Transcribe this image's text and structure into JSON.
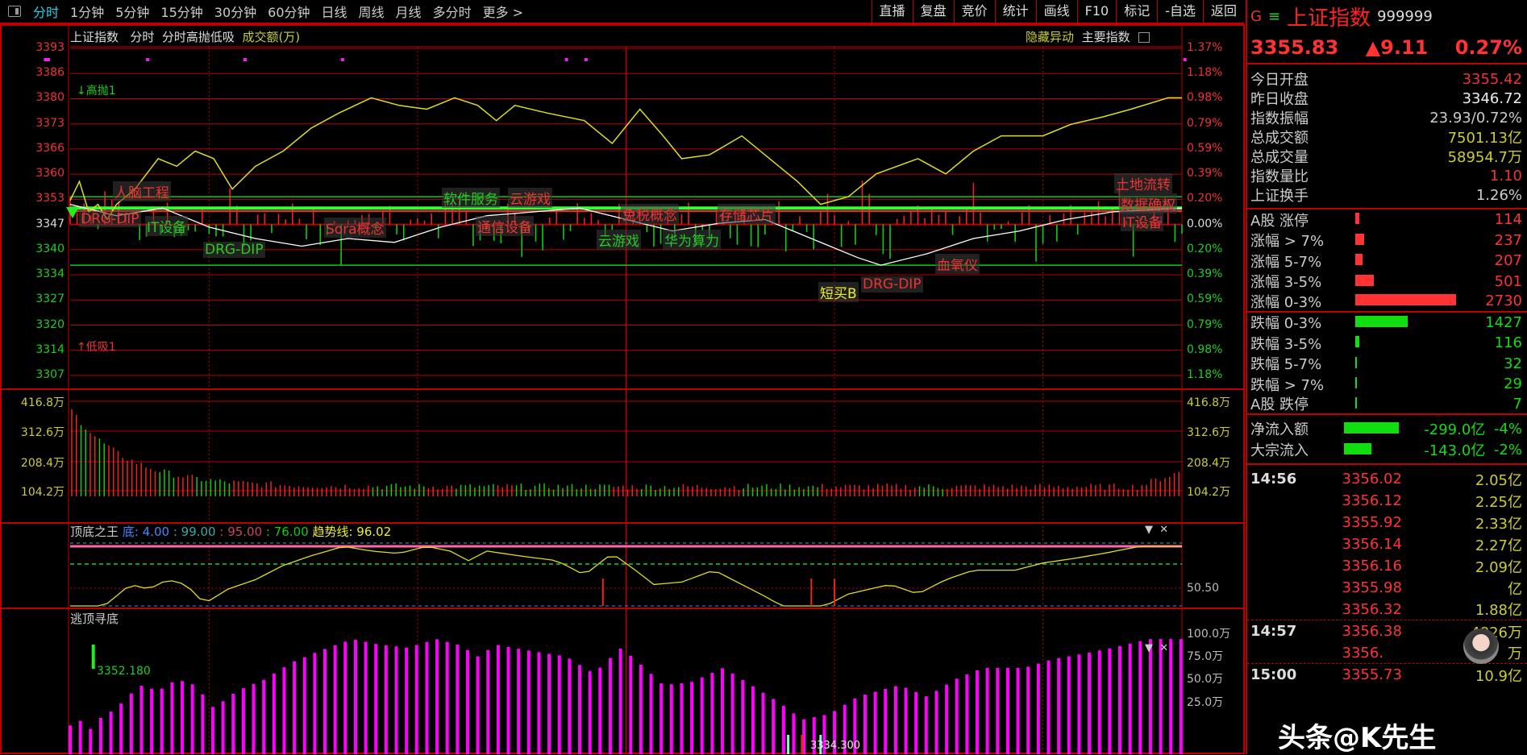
{
  "toolbar": {
    "tabs": [
      "分时",
      "1分钟",
      "5分钟",
      "15分钟",
      "30分钟",
      "60分钟",
      "日线",
      "周线",
      "月线",
      "多分时",
      "更多 >"
    ],
    "active_tab": "分时",
    "right_buttons": [
      "直播",
      "复盘",
      "竞价",
      "统计",
      "画线",
      "F10",
      "标记",
      "-自选",
      "返回"
    ]
  },
  "main_chart": {
    "title": "上证指数",
    "mode": "分时",
    "indicator": "分时高抛低吸",
    "volume_unit": "成交额(万)",
    "right_links": [
      "隐藏异动",
      "主要指数"
    ],
    "price_ticks": [
      "3393",
      "3386",
      "3380",
      "3373",
      "3366",
      "3360",
      "3353",
      "3347",
      "3340",
      "3334",
      "3327",
      "3320",
      "3314",
      "3307"
    ],
    "pct_ticks": [
      "1.37%",
      "1.18%",
      "0.98%",
      "0.79%",
      "0.59%",
      "0.39%",
      "0.20%",
      "0.00%",
      "0.20%",
      "0.39%",
      "0.59%",
      "0.79%",
      "0.98%",
      "1.18%"
    ],
    "volume_ticks": [
      "416.8万",
      "312.6万",
      "208.4万",
      "104.2万"
    ],
    "markers": {
      "sell": "高抛1",
      "buy": "低吸1"
    },
    "concept_labels": [
      {
        "text": "人脑工程",
        "color": "#e33"
      },
      {
        "text": "软件服务",
        "color": "#2c2"
      },
      {
        "text": "云游戏",
        "color": "#e33"
      },
      {
        "text": "DRG-DIP",
        "color": "#e33"
      },
      {
        "text": "IT设备",
        "color": "#2c2"
      },
      {
        "text": "DRG-DIP",
        "color": "#2c2"
      },
      {
        "text": "Sora概念",
        "color": "#e33"
      },
      {
        "text": "通信设备",
        "color": "#e33"
      },
      {
        "text": "免税概念",
        "color": "#e33"
      },
      {
        "text": "存储芯片",
        "color": "#e33"
      },
      {
        "text": "云游戏",
        "color": "#2c2"
      },
      {
        "text": "华为算力",
        "color": "#2c2"
      },
      {
        "text": "短买B",
        "color": "#ee3"
      },
      {
        "text": "DRG-DIP",
        "color": "#e33"
      },
      {
        "text": "血氧仪",
        "color": "#e33"
      },
      {
        "text": "土地流转",
        "color": "#e33"
      },
      {
        "text": "数据确权",
        "color": "#e33"
      },
      {
        "text": "IT设备",
        "color": "#e33"
      }
    ],
    "price_series": [
      [
        0,
        3353
      ],
      [
        2,
        3358
      ],
      [
        4,
        3350
      ],
      [
        6,
        3352
      ],
      [
        8,
        3348
      ],
      [
        10,
        3352
      ],
      [
        14,
        3356
      ],
      [
        19,
        3364
      ],
      [
        23,
        3362
      ],
      [
        27,
        3366
      ],
      [
        31,
        3364
      ],
      [
        35,
        3356
      ],
      [
        40,
        3362
      ],
      [
        46,
        3366
      ],
      [
        52,
        3372
      ],
      [
        58,
        3376
      ],
      [
        65,
        3380
      ],
      [
        71,
        3378
      ],
      [
        77,
        3377
      ],
      [
        83,
        3380
      ],
      [
        88,
        3378
      ],
      [
        92,
        3374
      ],
      [
        96,
        3378
      ],
      [
        103,
        3376
      ],
      [
        111,
        3374
      ],
      [
        117,
        3368
      ],
      [
        123,
        3377
      ],
      [
        128,
        3370
      ],
      [
        132,
        3364
      ],
      [
        138,
        3365
      ],
      [
        145,
        3370
      ],
      [
        151,
        3364
      ],
      [
        157,
        3358
      ],
      [
        162,
        3352
      ],
      [
        168,
        3354
      ],
      [
        174,
        3360
      ],
      [
        183,
        3364
      ],
      [
        189,
        3360
      ],
      [
        195,
        3366
      ],
      [
        201,
        3370
      ],
      [
        210,
        3370
      ],
      [
        216,
        3373
      ],
      [
        223,
        3375
      ],
      [
        229,
        3377
      ],
      [
        237,
        3380
      ],
      [
        240,
        3380
      ]
    ],
    "avg_series": [
      [
        0,
        3352
      ],
      [
        10,
        3349
      ],
      [
        20,
        3351
      ],
      [
        30,
        3346
      ],
      [
        40,
        3343
      ],
      [
        50,
        3341
      ],
      [
        60,
        3343
      ],
      [
        70,
        3342
      ],
      [
        80,
        3346
      ],
      [
        90,
        3349
      ],
      [
        100,
        3350
      ],
      [
        110,
        3351
      ],
      [
        120,
        3348
      ],
      [
        130,
        3345
      ],
      [
        140,
        3347
      ],
      [
        150,
        3348
      ],
      [
        160,
        3343
      ],
      [
        170,
        3338
      ],
      [
        175,
        3336
      ],
      [
        185,
        3339
      ],
      [
        195,
        3343
      ],
      [
        205,
        3345
      ],
      [
        215,
        3348
      ],
      [
        225,
        3350
      ],
      [
        240,
        3351
      ]
    ]
  },
  "indicator1": {
    "name": "顶底之王",
    "label_di": "底",
    "v1": ": 4.00",
    "v2": ": 99.00",
    "v3": ": 95.00",
    "v4": ": 76.00",
    "trend_label": "趋势线",
    "trend_value": ": 96.02",
    "axis_mid": "50.50"
  },
  "indicator2": {
    "name": "逃顶寻底",
    "annotation": "3352.180",
    "annotation2": "3334.300",
    "ticks": [
      "100.0万",
      "75.0万",
      "50.0万",
      "25.0万"
    ]
  },
  "quote": {
    "badge": "G",
    "menu": "≡",
    "name": "上证指数",
    "code": "999999",
    "price": "3355.83",
    "change": "▲9.11",
    "pct": "0.27%",
    "info": [
      {
        "label": "今日开盘",
        "value": "3355.42",
        "color": "#e33"
      },
      {
        "label": "昨日收盘",
        "value": "3346.72",
        "color": "#eee"
      },
      {
        "label": "指数振幅",
        "value": "23.93/0.72%",
        "color": "#ccc"
      },
      {
        "label": "总成交额",
        "value": "7501.13亿",
        "color": "#cc3"
      },
      {
        "label": "总成交量",
        "value": "58954.7万",
        "color": "#cc3"
      },
      {
        "label": "指数量比",
        "value": "1.10",
        "color": "#e33"
      },
      {
        "label": "上证换手",
        "value": "1.26%",
        "color": "#ccc"
      }
    ],
    "breadth": [
      {
        "label": "A股 涨停",
        "count": "114",
        "n": 114,
        "color": "#f33"
      },
      {
        "label": "涨幅 > 7%",
        "count": "237",
        "n": 237,
        "color": "#f33"
      },
      {
        "label": "涨幅 5-7%",
        "count": "207",
        "n": 207,
        "color": "#f33"
      },
      {
        "label": "涨幅 3-5%",
        "count": "501",
        "n": 501,
        "color": "#f33"
      },
      {
        "label": "涨幅 0-3%",
        "count": "2730",
        "n": 2730,
        "color": "#f33"
      },
      {
        "label": "跌幅 0-3%",
        "count": "1427",
        "n": 1427,
        "color": "#1d1"
      },
      {
        "label": "跌幅 3-5%",
        "count": "116",
        "n": 116,
        "color": "#1d1"
      },
      {
        "label": "跌幅 5-7%",
        "count": "32",
        "n": 32,
        "color": "#1d1"
      },
      {
        "label": "跌幅 > 7%",
        "count": "29",
        "n": 29,
        "color": "#1d1"
      },
      {
        "label": "A股 跌停",
        "count": "7",
        "n": 7,
        "color": "#1d1"
      }
    ],
    "flows": [
      {
        "label": "净流入额",
        "value": "-299.0亿",
        "pct": "-4%",
        "n": 4
      },
      {
        "label": "大宗流入",
        "value": "-143.0亿",
        "pct": "-2%",
        "n": 2
      }
    ],
    "ticks": [
      {
        "time": "14:56",
        "price": "3356.02",
        "amount": "2.05亿"
      },
      {
        "time": "",
        "price": "3356.12",
        "amount": "2.25亿"
      },
      {
        "time": "",
        "price": "3355.92",
        "amount": "2.33亿"
      },
      {
        "time": "",
        "price": "3356.14",
        "amount": "2.27亿"
      },
      {
        "time": "",
        "price": "3356.16",
        "amount": "2.09亿"
      },
      {
        "time": "",
        "price": "3355.98",
        "amount": "亿"
      },
      {
        "time": "",
        "price": "3356.32",
        "amount": "1.88亿"
      },
      {
        "time": "14:57",
        "price": "3356.38",
        "amount": "4826万"
      },
      {
        "time": "",
        "price": "3356.",
        "amount": "万"
      },
      {
        "time": "15:00",
        "price": "3355.73",
        "amount": "10.9亿"
      }
    ]
  },
  "watermark": "头条@K先生",
  "colors": {
    "up": "#ff3333",
    "down": "#11dd11",
    "grid": "#b00000",
    "price_line": "#dddd22",
    "avg_line": "#ffffff",
    "indicator2_bars": "#ff00ff"
  }
}
